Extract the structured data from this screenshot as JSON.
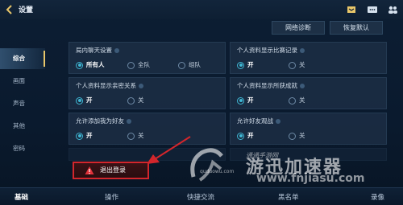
{
  "header": {
    "title": "设置"
  },
  "actions": {
    "network": "网络诊断",
    "restore": "恢复默认"
  },
  "sidebar": [
    {
      "label": "综合",
      "active": true
    },
    {
      "label": "画面",
      "active": false
    },
    {
      "label": "声音",
      "active": false
    },
    {
      "label": "其他",
      "active": false
    },
    {
      "label": "密码",
      "active": false
    }
  ],
  "settings": {
    "lan_chat": {
      "title": "局内聊天设置",
      "options": [
        "所有人",
        "全队",
        "组队"
      ]
    },
    "show_match_record": {
      "title": "个人资料显示比赛记录",
      "options": [
        "开",
        "关"
      ]
    },
    "show_intimate": {
      "title": "个人资料显示亲密关系",
      "options": [
        "开",
        "关"
      ]
    },
    "show_achievements": {
      "title": "个人资料显示所获成就",
      "options": [
        "开",
        "关"
      ]
    },
    "allow_friend": {
      "title": "允许添加我为好友",
      "options": [
        "开",
        "关"
      ]
    },
    "allow_spectate": {
      "title": "允许好友观战",
      "options": [
        "开",
        "关"
      ]
    }
  },
  "logout": {
    "label": "退出登录"
  },
  "bottom_tabs": [
    {
      "label": "基础",
      "active": true
    },
    {
      "label": "操作"
    },
    {
      "label": "快捷交流"
    },
    {
      "label": "黑名单"
    },
    {
      "label": "录像"
    }
  ],
  "watermark": {
    "title": "游迅加速器",
    "subtitle": "通通手游网",
    "domain": "quduowu.com",
    "url": "www.fnjiasu.com"
  },
  "colors": {
    "accent": "#3fb6d3",
    "gold": "#e9c76a",
    "danger": "#d3262c"
  }
}
